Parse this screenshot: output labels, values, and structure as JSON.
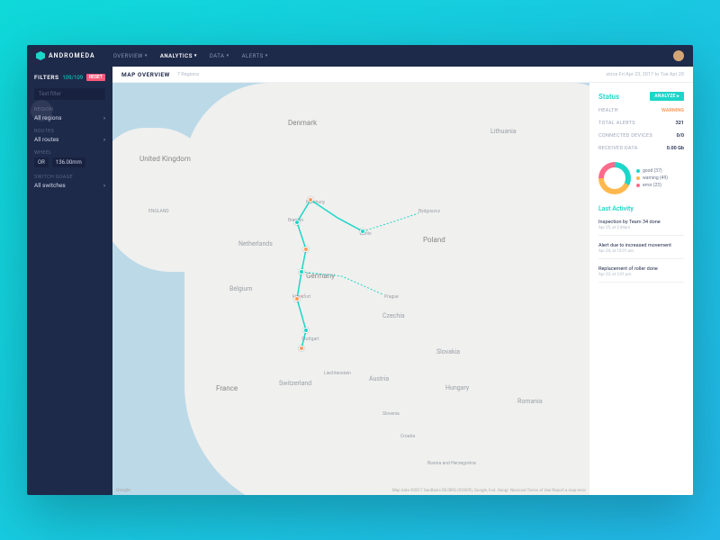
{
  "brand": "ANDROMEDA",
  "nav": {
    "tabs": [
      {
        "label": "OVERVIEW"
      },
      {
        "label": "ANALYTICS",
        "active": true
      },
      {
        "label": "DATA"
      },
      {
        "label": "ALERTS"
      }
    ]
  },
  "sidebar": {
    "filters_title": "FILTERS",
    "filters_count": "109/109",
    "reset": "RESET",
    "search_placeholder": "Text filter",
    "region": {
      "label": "REGION",
      "value": "All regions"
    },
    "routes": {
      "label": "ROUTES",
      "value": "All routes"
    },
    "wheel": {
      "label": "WHEEL",
      "op": "OR",
      "value": "136.00mm"
    },
    "switch_guage": {
      "label": "SWITCH GUAGE",
      "value": "All switches"
    }
  },
  "subheader": {
    "title": "MAP OVERVIEW",
    "sub": "7 Regions",
    "date": "since Fri Apr 23, 2017 to Tue Apr 28"
  },
  "map": {
    "labels": {
      "uk": "United Kingdom",
      "england": "ENGLAND",
      "denmark": "Denmark",
      "netherlands": "Netherlands",
      "belgium": "Belgium",
      "germany": "Germany",
      "france": "France",
      "switzerland": "Switzerland",
      "liechtenstein": "Liechtenstein",
      "austria": "Austria",
      "czechia": "Czechia",
      "poland": "Poland",
      "lithuania": "Lithuania",
      "slovakia": "Slovakia",
      "hungary": "Hungary",
      "slovenia": "Slovenia",
      "croatia": "Croatia",
      "bosnia": "Bosnia and Herzegovina",
      "romania": "Romania",
      "hamburg": "Hamburg",
      "bremen": "Bremen",
      "berlin": "Berlin",
      "frankfurt": "Frankfurt",
      "stuttgart": "Stuttgart",
      "prague": "Prague",
      "bydgoszcz": "Bydgoszcz"
    },
    "attrib": "Google",
    "attrib2": "Map data ©2017 GeoBasis-DE/BKG (©2009), Google, Inst. Geogr. Nacional   Terms of Use   Report a map error"
  },
  "status": {
    "title": "Status",
    "analyze": "ANALYZE ▸",
    "rows": [
      {
        "label": "HEALTH",
        "value": "WARNING",
        "warning": true
      },
      {
        "label": "TOTAL ALERTS",
        "value": "321"
      },
      {
        "label": "CONNECTED DEVICES",
        "value": "0/0"
      },
      {
        "label": "RECEIVED DATA",
        "value": "0.00 Gb"
      }
    ],
    "legend": [
      {
        "label": "good (37)",
        "cls": "g"
      },
      {
        "label": "warning (49)",
        "cls": "w"
      },
      {
        "label": "error (23)",
        "cls": "e"
      }
    ]
  },
  "activity": {
    "title": "Last Activity",
    "items": [
      {
        "text": "Inspection by Team 34 done",
        "time": "Apr 25, at 2:44am"
      },
      {
        "text": "Alert due to increased movement",
        "time": "Apr 24, at 12:01 am"
      },
      {
        "text": "Replacement of roller done",
        "time": "Apr 23, at 3:01 pm"
      }
    ]
  }
}
